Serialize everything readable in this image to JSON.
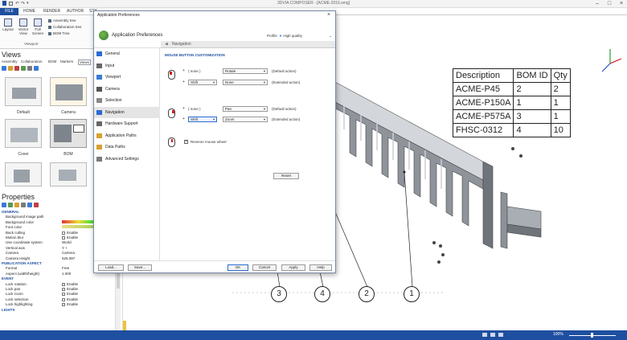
{
  "window": {
    "title": "3DVIA COMPOSER - [ACME-2016.smg]"
  },
  "ribbon": {
    "tabs": [
      "FILE",
      "HOME",
      "RENDER",
      "AUTHOR",
      "STY"
    ],
    "buttons": [
      {
        "label": "Layout"
      },
      {
        "label": "Vector View"
      },
      {
        "label": "Full Screen"
      }
    ],
    "checks": [
      {
        "label": "Assembly tree",
        "checked": true
      },
      {
        "label": "Collaboration tree",
        "checked": true
      },
      {
        "label": "BOM Tree",
        "checked": true
      }
    ],
    "group_label": "Viewport"
  },
  "views": {
    "title": "Views",
    "tabs": [
      "Assembly",
      "Collaboration",
      "BOM",
      "Markers",
      "Views"
    ],
    "items": [
      {
        "label": "Default"
      },
      {
        "label": "Camera"
      },
      {
        "label": "Cover"
      },
      {
        "label": "BOM"
      },
      {
        "label": ""
      },
      {
        "label": ""
      }
    ]
  },
  "properties": {
    "title": "Properties",
    "rows": [
      {
        "k": "GENERAL",
        "v": "",
        "cat": true
      },
      {
        "k": "Background image path",
        "v": ""
      },
      {
        "k": "Background color",
        "v": ""
      },
      {
        "k": "Foot color",
        "v": ""
      },
      {
        "k": "Back culling",
        "v": "Enable"
      },
      {
        "k": "Motion blur",
        "v": "Enable"
      },
      {
        "k": "Use coordinate system",
        "v": "World"
      },
      {
        "k": "Vertical axis",
        "v": "Y +"
      },
      {
        "k": "Camera",
        "v": "Camera"
      },
      {
        "k": "Camera Height",
        "v": "525.087"
      },
      {
        "k": "PUBLICATION ASPECT",
        "v": "",
        "cat": true
      },
      {
        "k": "Format",
        "v": "Free"
      },
      {
        "k": "Aspect (width/height)",
        "v": "1.000"
      },
      {
        "k": "EVENT",
        "v": "",
        "cat": true
      },
      {
        "k": "Lock rotation",
        "v": "Enable"
      },
      {
        "k": "Lock pan",
        "v": "Enable"
      },
      {
        "k": "Lock zoom",
        "v": "Enable"
      },
      {
        "k": "Lock selection",
        "v": "Enable"
      },
      {
        "k": "Lock highlighting",
        "v": "Enable"
      },
      {
        "k": "LIGHTS",
        "v": "",
        "cat": true
      }
    ]
  },
  "bom_table": {
    "headers": [
      "Description",
      "BOM ID",
      "Qty"
    ],
    "rows": [
      [
        "ACME-P45",
        "2",
        "2"
      ],
      [
        "ACME-P150A",
        "1",
        "1"
      ],
      [
        "ACME-P575A",
        "3",
        "1"
      ],
      [
        "FHSC-0312",
        "4",
        "10"
      ]
    ]
  },
  "balloons": [
    "3",
    "4",
    "2",
    "1"
  ],
  "status": {
    "zoom": "100%"
  },
  "dialog": {
    "title": "Application Preferences",
    "header_title": "Application Preferences",
    "profile_label": "Profile",
    "profile_value": "High quality",
    "nav": [
      "General",
      "Input",
      "Viewport",
      "Camera",
      "Selection",
      "Navigation",
      "Hardware Support",
      "Application Paths",
      "Data Paths",
      "Advanced Settings"
    ],
    "active_nav": "Navigation",
    "content_title": "Navigation",
    "section_title": "MOUSE BUTTON CUSTOMIZATION",
    "groups": [
      {
        "rows": [
          {
            "modifier": "( none )",
            "action": "Rotate",
            "desc": "(Default action)"
          },
          {
            "modifier": "Shift",
            "action": "None",
            "desc": "(Extended action)"
          }
        ]
      },
      {
        "rows": [
          {
            "modifier": "( none )",
            "action": "Pan",
            "desc": "(Default action)"
          },
          {
            "modifier": "Shift",
            "action": "Zoom",
            "desc": "(Extended action)"
          }
        ]
      }
    ],
    "reverse_wheel_label": "Reverse mouse wheel",
    "reset_label": "Reset",
    "footer": {
      "load": "Load...",
      "save": "Save...",
      "ok": "OK",
      "cancel": "Cancel",
      "apply": "Apply",
      "help": "Help"
    }
  }
}
